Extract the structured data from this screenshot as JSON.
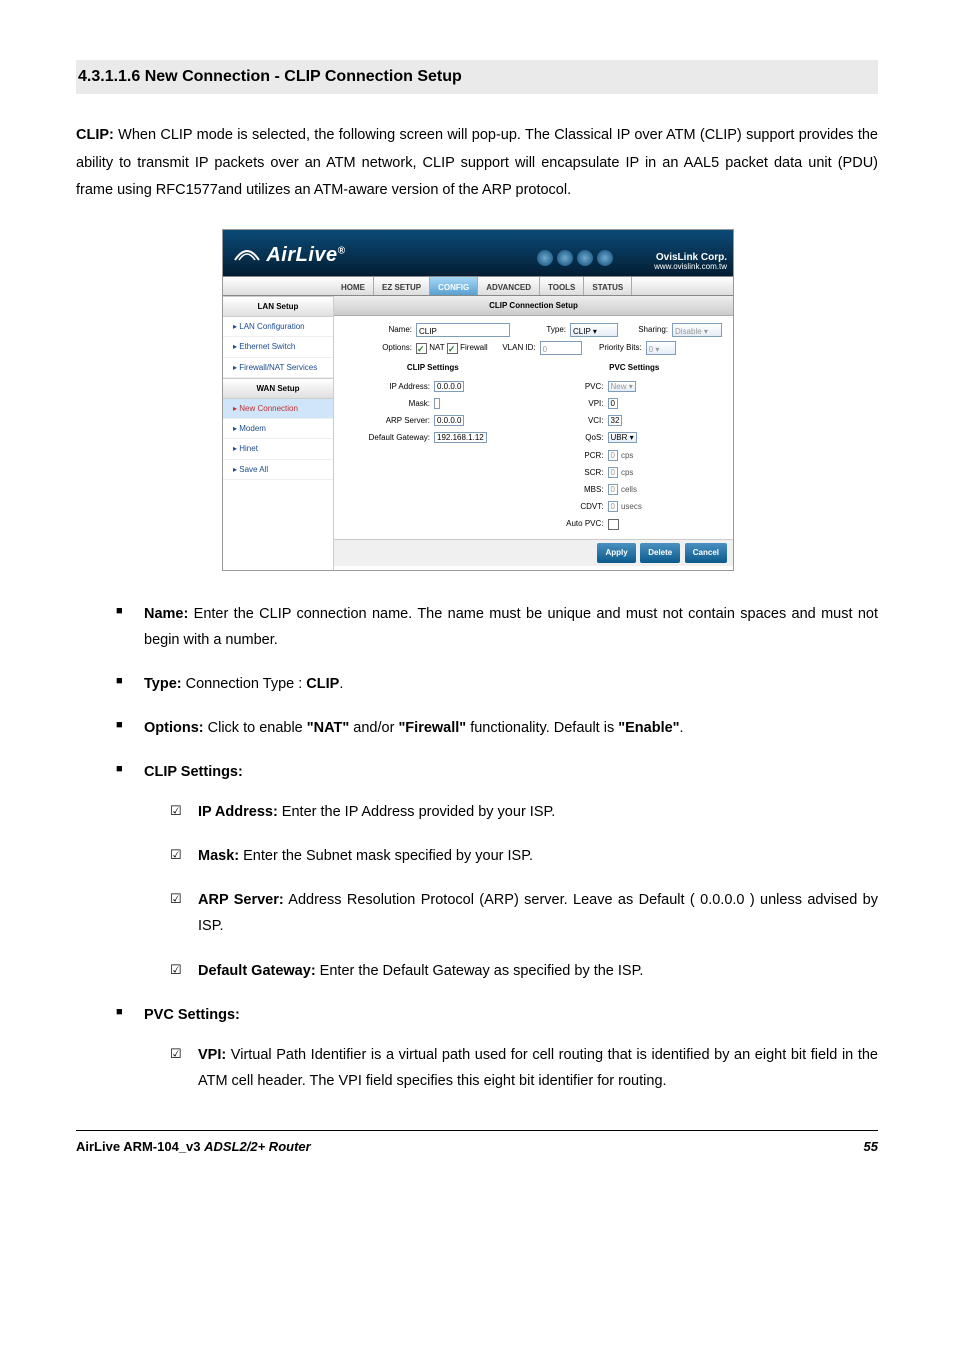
{
  "heading": "4.3.1.1.6 New Connection - CLIP Connection Setup",
  "intro": {
    "lead": "CLIP:",
    "text": " When CLIP mode is selected, the following screen will pop-up. The Classical IP over ATM (CLIP) support provides the ability to transmit IP packets over an ATM network, CLIP support will encapsulate IP in an AAL5 packet data unit (PDU) frame using RFC1577and utilizes an ATM-aware version of the ARP protocol."
  },
  "screenshot": {
    "logo": "AirLive",
    "corp_name": "OvisLink Corp.",
    "corp_url": "www.ovislink.com.tw",
    "topnav": [
      "HOME",
      "EZ SETUP",
      "CONFIG",
      "ADVANCED",
      "TOOLS",
      "STATUS"
    ],
    "topnav_active": 2,
    "side_groups": [
      {
        "head": "LAN Setup",
        "items": [
          "LAN Configuration",
          "Ethernet Switch",
          "Firewall/NAT Services"
        ]
      },
      {
        "head": "WAN Setup",
        "items": [
          "New Connection",
          "Modem",
          "Hinet",
          "Save All"
        ],
        "hilite": 0
      }
    ],
    "panel_title": "CLIP Connection Setup",
    "row1": {
      "name_label": "Name:",
      "name_value": "CLIP",
      "type_label": "Type:",
      "type_value": "CLIP",
      "sharing_label": "Sharing:",
      "sharing_value": "Disable"
    },
    "row2": {
      "options_label": "Options:",
      "nat": "NAT",
      "firewall": "Firewall",
      "vlan_label": "VLAN ID:",
      "vlan_value": "0",
      "pbits_label": "Priority Bits:",
      "pbits_value": "0"
    },
    "left_col": {
      "head": "CLIP Settings",
      "ip_label": "IP Address:",
      "ip": "0.0.0.0",
      "mask_label": "Mask:",
      "mask": "",
      "arp_label": "ARP Server:",
      "arp": "0.0.0.0",
      "gw_label": "Default Gateway:",
      "gw": "192.168.1.12"
    },
    "right_col": {
      "head": "PVC Settings",
      "pvc_label": "PVC:",
      "pvc": "New",
      "vpi_label": "VPI:",
      "vpi": "0",
      "vci_label": "VCI:",
      "vci": "32",
      "qos_label": "QoS:",
      "qos": "UBR",
      "pcr_label": "PCR:",
      "pcr": "0",
      "pcr_u": "cps",
      "scr_label": "SCR:",
      "scr": "0",
      "scr_u": "cps",
      "mbs_label": "MBS:",
      "mbs": "0",
      "mbs_u": "cells",
      "cdvt_label": "CDVT:",
      "cdvt": "0",
      "cdvt_u": "usecs",
      "auto_label": "Auto PVC:"
    },
    "buttons": [
      "Apply",
      "Delete",
      "Cancel"
    ]
  },
  "bullets": {
    "name": {
      "t": "Name:",
      "d": " Enter the CLIP connection name. The name must be unique and must not contain spaces and must not begin with a number."
    },
    "type_pre": "Type:",
    "type_mid": " Connection Type : ",
    "type_val": "CLIP",
    "type_post": ".",
    "options": {
      "t": "Options:",
      "p1": " Click to enable ",
      "n": "\"NAT\"",
      "p2": " and/or ",
      "f": "\"Firewall\"",
      "p3": " functionality. Default is ",
      "e": "\"Enable\"",
      "p4": "."
    },
    "clip_head": "CLIP Settings:",
    "ip": {
      "t": "IP Address:",
      "d": " Enter the IP Address provided by your ISP."
    },
    "mask": {
      "t": "Mask:",
      "d": " Enter the Subnet mask specified by your ISP."
    },
    "arp": {
      "t": "ARP Server:",
      "d": " Address Resolution Protocol (ARP) server. Leave as Default ( 0.0.0.0 ) unless advised by ISP."
    },
    "gw": {
      "t": "Default Gateway:",
      "d": " Enter the Default Gateway as specified by the ISP."
    },
    "pvc_head": "PVC Settings:",
    "vpi": {
      "t": "VPI:",
      "d": " Virtual Path Identifier is a virtual path used for cell routing that is identified by an eight bit field in the ATM cell header. The VPI field specifies this eight bit identifier for routing."
    }
  },
  "footer": {
    "product": "AirLive ARM-104_v3 ",
    "model": "ADSL2/2+ Router",
    "page": "55"
  }
}
